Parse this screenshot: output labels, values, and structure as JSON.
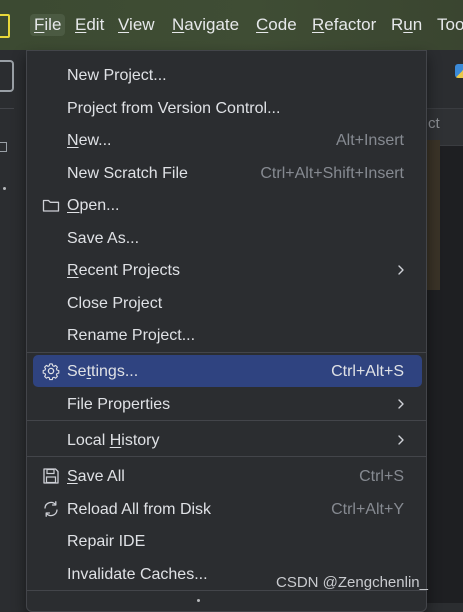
{
  "menubar": {
    "items": [
      {
        "label": "File",
        "mnemonic": "F",
        "rest": "ile"
      },
      {
        "label": "Edit",
        "mnemonic": "E",
        "rest": "dit"
      },
      {
        "label": "View",
        "mnemonic": "V",
        "rest": "iew"
      },
      {
        "label": "Navigate",
        "mnemonic": "N",
        "rest": "avigate"
      },
      {
        "label": "Code",
        "mnemonic": "C",
        "rest": "ode"
      },
      {
        "label": "Refactor",
        "mnemonic": "R",
        "rest": "efactor"
      },
      {
        "label": "Run",
        "mnemonic": "",
        "rest": "Run",
        "pre": "R",
        "mid": "u",
        "post": "n"
      },
      {
        "label": "Tools",
        "mnemonic": "",
        "rest": "Too"
      }
    ],
    "colors": {
      "background": "#3c4a32",
      "active": "#4b5a42"
    }
  },
  "file_menu": {
    "new_project": {
      "label": "New Project..."
    },
    "project_from_vcs": {
      "label": "Project from Version Control..."
    },
    "new": {
      "pre": "",
      "mnemonic": "N",
      "post": "ew...",
      "shortcut": "Alt+Insert"
    },
    "new_scratch": {
      "label": "New Scratch File",
      "shortcut": "Ctrl+Alt+Shift+Insert"
    },
    "open": {
      "pre": "",
      "mnemonic": "O",
      "post": "pen...",
      "icon": "folder-icon"
    },
    "save_as": {
      "label": "Save As..."
    },
    "recent_projects": {
      "pre": "",
      "mnemonic": "R",
      "post": "ecent Projects"
    },
    "close_project": {
      "label": "Close Project"
    },
    "rename_project": {
      "label": "Rename Project..."
    },
    "settings": {
      "pre": "Se",
      "mnemonic": "t",
      "post": "tings...",
      "shortcut": "Ctrl+Alt+S",
      "icon": "gear-icon"
    },
    "file_properties": {
      "label": "File Properties"
    },
    "local_history": {
      "pre": "Local ",
      "mnemonic": "H",
      "post": "istory"
    },
    "save_all": {
      "pre": "",
      "mnemonic": "S",
      "post": "ave All",
      "shortcut": "Ctrl+S",
      "icon": "save-icon"
    },
    "reload_all": {
      "label": "Reload All from Disk",
      "shortcut": "Ctrl+Alt+Y",
      "icon": "reload-icon"
    },
    "repair_ide": {
      "label": "Repair IDE"
    },
    "invalidate_caches": {
      "label": "Invalidate Caches..."
    }
  },
  "background": {
    "tab_fragment": "ct"
  },
  "watermark": "CSDN @Zengchenlin_",
  "colors": {
    "selection": "#2f4380",
    "menu_bg": "#2b2d30",
    "shortcut_text": "#868a91",
    "text": "#dfe1e5"
  }
}
